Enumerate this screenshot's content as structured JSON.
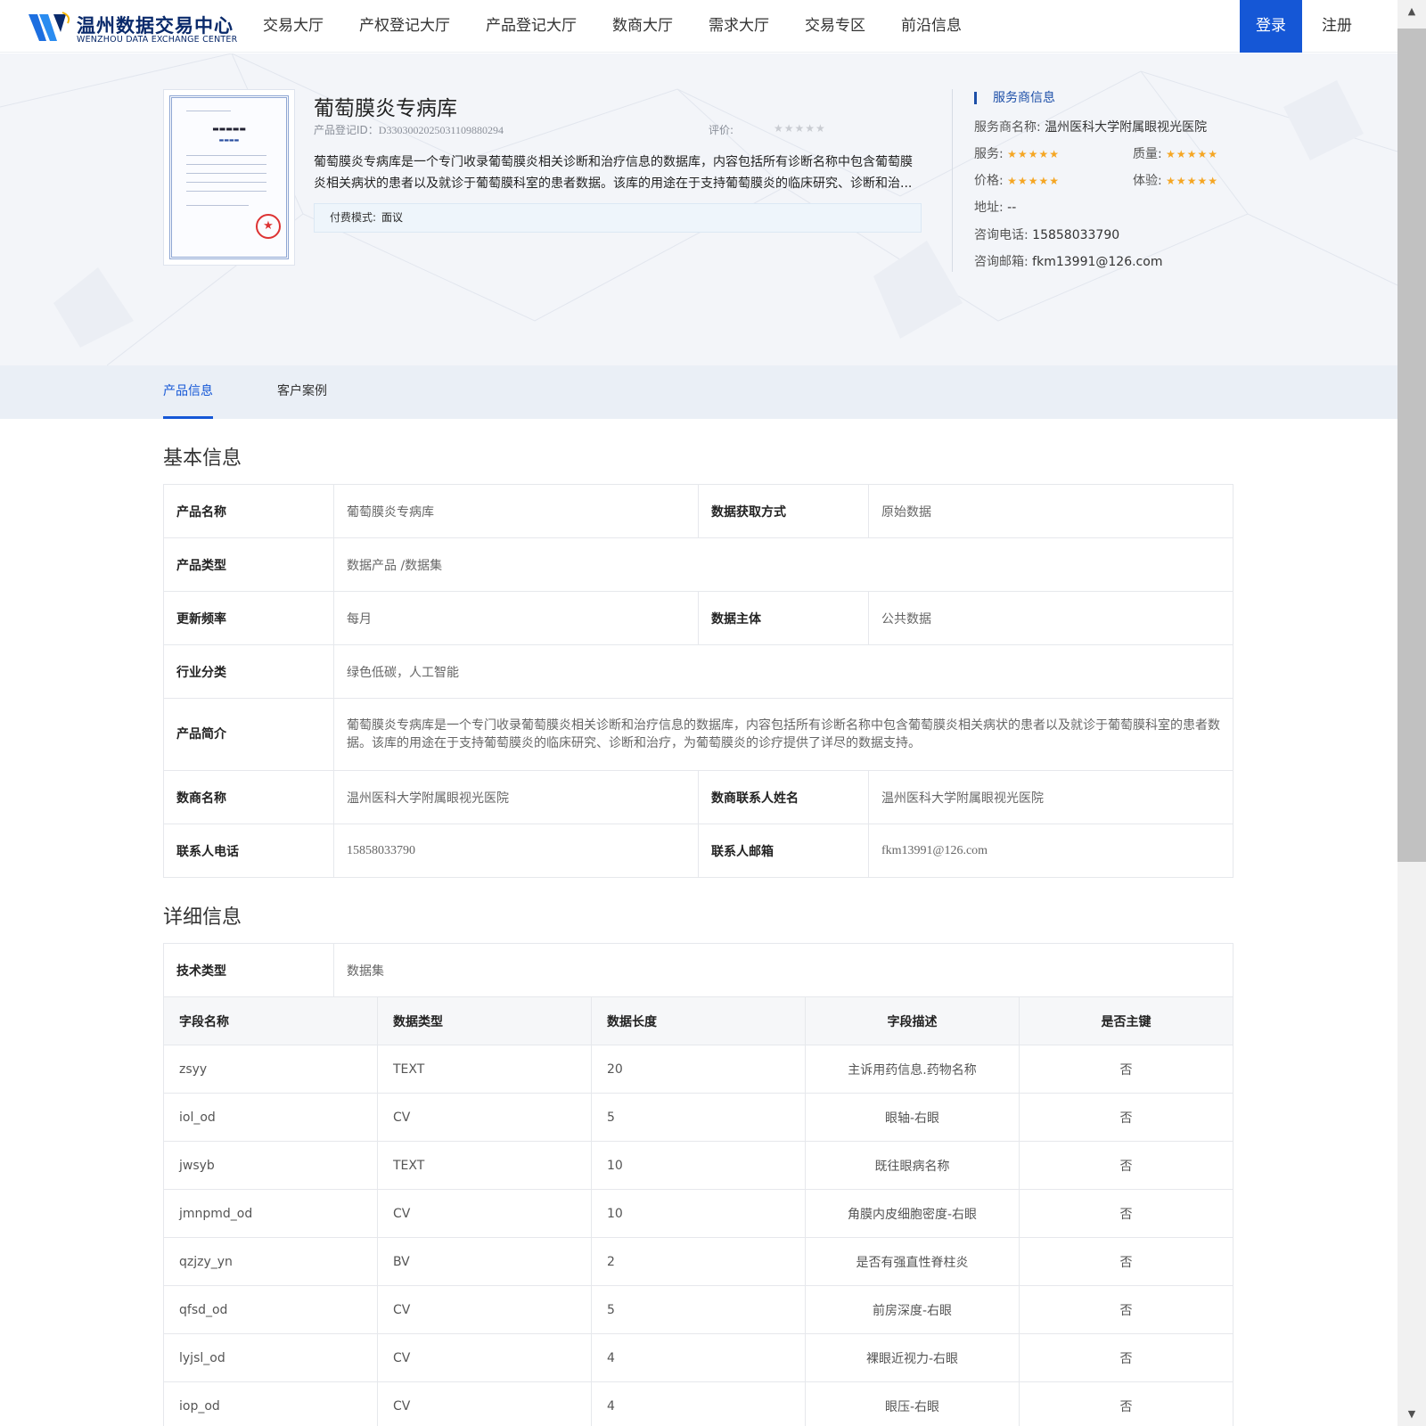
{
  "header": {
    "logo_cn": "温州数据交易中心",
    "logo_en": "WENZHOU DATA EXCHANGE CENTER",
    "nav": [
      "交易大厅",
      "产权登记大厅",
      "产品登记大厅",
      "数商大厅",
      "需求大厅",
      "交易专区",
      "前沿信息"
    ],
    "login": "登录",
    "register": "注册"
  },
  "product": {
    "title": "葡萄膜炎专病库",
    "id_label": "产品登记ID：",
    "id_value": "D330300202503110988029​4",
    "rating_label": "评价:",
    "rating_stars": "★★★★★",
    "description": "葡萄膜炎专病库是一个专门收录葡萄膜炎相关诊断和治疗信息的数据库，内容包括所有诊断名称中包含葡萄膜炎相关病状的患者以及就诊于葡萄膜科室的患者数据。该库的用途在于支持葡萄膜炎的临床研究、诊断和治...",
    "pay_label": "付费模式:",
    "pay_value": "面议"
  },
  "provider": {
    "title": "服务商信息",
    "name_label": "服务商名称:",
    "name_value": "温州医科大学附属眼视光医院",
    "service_label": "服务:",
    "quality_label": "质量:",
    "price_label": "价格:",
    "experience_label": "体验:",
    "stars": "★★★★★",
    "address_label": "地址:",
    "address_value": "--",
    "phone_label": "咨询电话:",
    "phone_value": "15858033790",
    "email_label": "咨询邮箱:",
    "email_value": "fkm13991@126.com"
  },
  "tabs": [
    "产品信息",
    "客户案例"
  ],
  "basic": {
    "title": "基本信息",
    "product_name_k": "产品名称",
    "product_name_v": "葡萄膜炎专病库",
    "acquire_k": "数据获取方式",
    "acquire_v": "原始数据",
    "type_k": "产品类型",
    "type_v": "数据产品 /数据集",
    "freq_k": "更新频率",
    "freq_v": "每月",
    "subject_k": "数据主体",
    "subject_v": "公共数据",
    "industry_k": "行业分类",
    "industry_v": "绿色低碳，人工智能",
    "intro_k": "产品简介",
    "intro_v": "葡萄膜炎专病库是一个专门收录葡萄膜炎相关诊断和治疗信息的数据库，内容包括所有诊断名称中包含葡萄膜炎相关病状的患者以及就诊于葡萄膜科室的患者数据。该库的用途在于支持葡萄膜炎的临床研究、诊断和治疗，为葡萄膜炎的诊疗提供了详尽的数据支持。",
    "merchant_k": "数商名称",
    "merchant_v": "温州医科大学附属眼视光医院",
    "contact_k": "数商联系人姓名",
    "contact_v": "温州医科大学附属眼视光医院",
    "phone_k": "联系人电话",
    "phone_v": "15858033790",
    "email_k": "联系人邮箱",
    "email_v": "fkm13991@126.com"
  },
  "detail": {
    "title": "详细信息",
    "tech_k": "技术类型",
    "tech_v": "数据集",
    "columns": [
      "字段名称",
      "数据类型",
      "数据长度",
      "字段描述",
      "是否主键"
    ],
    "rows": [
      [
        "zsyy",
        "TEXT",
        "20",
        "主诉用药信息.药物名称",
        "否"
      ],
      [
        "iol_od",
        "CV",
        "5",
        "眼轴-右眼",
        "否"
      ],
      [
        "jwsyb",
        "TEXT",
        "10",
        "既往眼病名称",
        "否"
      ],
      [
        "jmnpmd_od",
        "CV",
        "10",
        "角膜内皮细胞密度-右眼",
        "否"
      ],
      [
        "qzjzy_yn",
        "BV",
        "2",
        "是否有强直性脊柱炎",
        "否"
      ],
      [
        "qfsd_od",
        "CV",
        "5",
        "前房深度-右眼",
        "否"
      ],
      [
        "lyjsl_od",
        "CV",
        "4",
        "裸眼近视力-右眼",
        "否"
      ],
      [
        "iop_od",
        "CV",
        "4",
        "眼压-右眼",
        "否"
      ]
    ]
  },
  "colors": {
    "primary": "#1557d6",
    "star": "#f5a623"
  }
}
